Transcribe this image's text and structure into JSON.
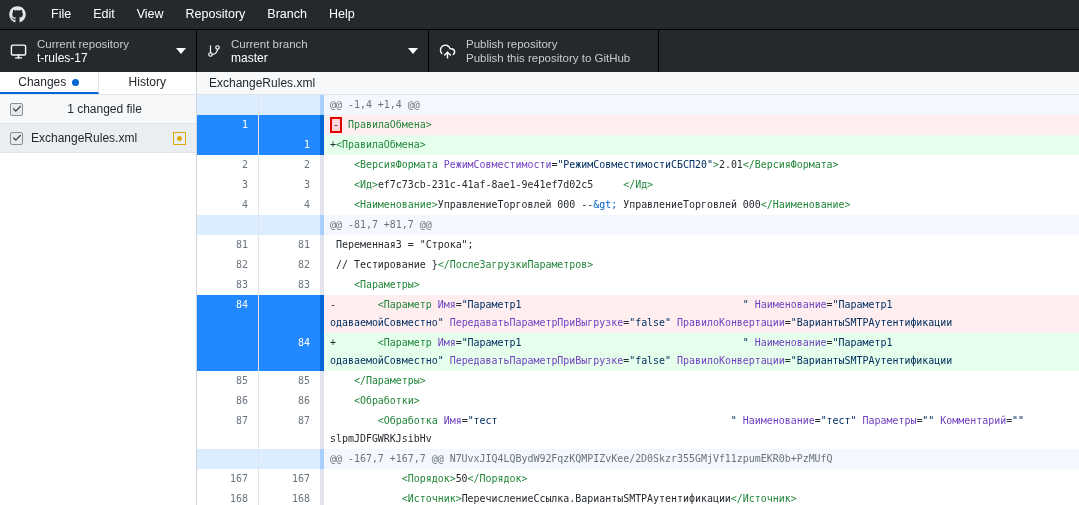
{
  "menu": [
    "File",
    "Edit",
    "View",
    "Repository",
    "Branch",
    "Help"
  ],
  "toolbar": {
    "repository": {
      "label": "Current repository",
      "value": "t-rules-17"
    },
    "branch": {
      "label": "Current branch",
      "value": "master"
    },
    "publish": {
      "label": "Publish repository",
      "value": "Publish this repository to GitHub"
    }
  },
  "tabs": [
    {
      "label": "Changes",
      "selected": true,
      "badge": true
    },
    {
      "label": "History",
      "selected": false,
      "badge": false
    }
  ],
  "changes": {
    "header": {
      "label": "1 changed file",
      "checked": true
    },
    "files": [
      {
        "name": "ExchangeRules.xml",
        "checked": true,
        "selected": true,
        "kind": "modified"
      }
    ]
  },
  "diff": {
    "file": "ExchangeRules.xml",
    "rows": [
      {
        "kind": "hunk",
        "lines": [
          [
            {
              "kind": "plain",
              "t": "@@ -1,4 +1,4 @@"
            }
          ]
        ]
      },
      {
        "kind": "del",
        "old": "1",
        "selected": true,
        "marker": true,
        "lines": [
          [
            {
              "kind": "text",
              "t": "-"
            },
            {
              "kind": "tag",
              "t": " ПравилаОбмена>"
            }
          ]
        ]
      },
      {
        "kind": "add",
        "new": "1",
        "selected": true,
        "lines": [
          [
            {
              "kind": "text",
              "t": "+"
            },
            {
              "kind": "tag",
              "t": "<ПравилаОбмена>"
            }
          ]
        ]
      },
      {
        "kind": "ctx",
        "old": "2",
        "new": "2",
        "selected": false,
        "lines": [
          [
            {
              "kind": "tag",
              "t": "    <ВерсияФормата"
            },
            {
              "kind": "attr",
              "t": " РежимСовместимости"
            },
            {
              "kind": "text",
              "t": "="
            },
            {
              "kind": "str",
              "t": "\"РежимСовместимостиСБСП20\""
            },
            {
              "kind": "tag",
              "t": ">"
            },
            {
              "kind": "text",
              "t": "2.01"
            },
            {
              "kind": "tag",
              "t": "</ВерсияФормата>"
            }
          ]
        ]
      },
      {
        "kind": "ctx",
        "old": "3",
        "new": "3",
        "selected": false,
        "lines": [
          [
            {
              "kind": "tag",
              "t": "    <Ид>"
            },
            {
              "kind": "text",
              "t": "ef7c73cb-231c-41af-8ae1-9e41ef7d02c5"
            },
            {
              "kind": "tag",
              "t": "     </Ид>"
            }
          ]
        ]
      },
      {
        "kind": "ctx",
        "old": "4",
        "new": "4",
        "selected": false,
        "lines": [
          [
            {
              "kind": "tag",
              "t": "    <Наименование>"
            },
            {
              "kind": "text",
              "t": "УправлениеТорговлей 000 --"
            },
            {
              "kind": "entity",
              "t": "&gt;"
            },
            {
              "kind": "text",
              "t": " УправлениеТорговлей 000"
            },
            {
              "kind": "tag",
              "t": "</Наименование>"
            }
          ]
        ]
      },
      {
        "kind": "hunk",
        "lines": [
          [
            {
              "kind": "plain",
              "t": "@@ -81,7 +81,7 @@"
            }
          ]
        ]
      },
      {
        "kind": "ctx",
        "old": "81",
        "new": "81",
        "selected": false,
        "lines": [
          [
            {
              "kind": "text",
              "t": " Переменная3 = \"Строка\";"
            }
          ]
        ]
      },
      {
        "kind": "ctx",
        "old": "82",
        "new": "82",
        "selected": false,
        "lines": [
          [
            {
              "kind": "text",
              "t": " // Тестирование }"
            },
            {
              "kind": "tag",
              "t": "</ПослеЗагрузкиПараметров>"
            }
          ]
        ]
      },
      {
        "kind": "ctx",
        "old": "83",
        "new": "83",
        "selected": false,
        "lines": [
          [
            {
              "kind": "tag",
              "t": "    <Параметры>"
            }
          ]
        ]
      },
      {
        "kind": "del",
        "old": "84",
        "selected": true,
        "lines": [
          [
            {
              "kind": "text",
              "t": "-"
            },
            {
              "kind": "tag",
              "t": "       <Параметр"
            },
            {
              "kind": "attr",
              "t": " Имя"
            },
            {
              "kind": "text",
              "t": "="
            },
            {
              "kind": "str",
              "t": "\"Параметр1                                     \""
            },
            {
              "kind": "attr",
              "t": " Наименование"
            },
            {
              "kind": "text",
              "t": "="
            },
            {
              "kind": "str",
              "t": "\"Параметр1"
            }
          ],
          [
            {
              "kind": "str",
              "t": "одаваемойСовместно\""
            },
            {
              "kind": "attr",
              "t": " ПередаватьПараметрПриВыгрузке"
            },
            {
              "kind": "text",
              "t": "="
            },
            {
              "kind": "str",
              "t": "\"false\""
            },
            {
              "kind": "attr",
              "t": " ПравилоКонвертации"
            },
            {
              "kind": "text",
              "t": "="
            },
            {
              "kind": "str",
              "t": "\"ВариантыSMTPАутентификации"
            }
          ]
        ]
      },
      {
        "kind": "add",
        "new": "84",
        "selected": true,
        "lines": [
          [
            {
              "kind": "text",
              "t": "+"
            },
            {
              "kind": "tag",
              "t": "       <Параметр"
            },
            {
              "kind": "attr",
              "t": " Имя"
            },
            {
              "kind": "text",
              "t": "="
            },
            {
              "kind": "str",
              "t": "\"Параметр1                                     \""
            },
            {
              "kind": "attr",
              "t": " Наименование"
            },
            {
              "kind": "text",
              "t": "="
            },
            {
              "kind": "str",
              "t": "\"Параметр1"
            }
          ],
          [
            {
              "kind": "str",
              "t": "одаваемойСовместно\""
            },
            {
              "kind": "attr",
              "t": " ПередаватьПараметрПриВыгрузке"
            },
            {
              "kind": "text",
              "t": "="
            },
            {
              "kind": "str",
              "t": "\"false\""
            },
            {
              "kind": "attr",
              "t": " ПравилоКонвертации"
            },
            {
              "kind": "text",
              "t": "="
            },
            {
              "kind": "str",
              "t": "\"ВариантыSMTPАутентификации"
            }
          ]
        ]
      },
      {
        "kind": "ctx",
        "old": "85",
        "new": "85",
        "selected": false,
        "lines": [
          [
            {
              "kind": "tag",
              "t": "    </Параметры>"
            }
          ]
        ]
      },
      {
        "kind": "ctx",
        "old": "86",
        "new": "86",
        "selected": false,
        "lines": [
          [
            {
              "kind": "tag",
              "t": "    <Обработки>"
            }
          ]
        ]
      },
      {
        "kind": "ctx",
        "old": "87",
        "new": "87",
        "selected": false,
        "lines": [
          [
            {
              "kind": "tag",
              "t": "        <Обработка"
            },
            {
              "kind": "attr",
              "t": " Имя"
            },
            {
              "kind": "text",
              "t": "="
            },
            {
              "kind": "str",
              "t": "\"тест                                       \""
            },
            {
              "kind": "attr",
              "t": " Наименование"
            },
            {
              "kind": "text",
              "t": "="
            },
            {
              "kind": "str",
              "t": "\"тест\""
            },
            {
              "kind": "attr",
              "t": " Параметры"
            },
            {
              "kind": "text",
              "t": "="
            },
            {
              "kind": "str",
              "t": "\"\""
            },
            {
              "kind": "attr",
              "t": " Комментарий"
            },
            {
              "kind": "text",
              "t": "="
            },
            {
              "kind": "str",
              "t": "\"\""
            }
          ],
          [
            {
              "kind": "text",
              "t": "slpmJDFGWRKJsibHv"
            }
          ]
        ]
      },
      {
        "kind": "hunk",
        "lines": [
          [
            {
              "kind": "plain",
              "t": "@@ -167,7 +167,7 @@ N7UvxJIQ4LQBydW92FqzKQMPIZvKee/2D0Skzr355GMjVf11zpumEKR0b+PzMUfQ"
            }
          ]
        ]
      },
      {
        "kind": "ctx",
        "old": "167",
        "new": "167",
        "selected": false,
        "lines": [
          [
            {
              "kind": "tag",
              "t": "            <Порядок>"
            },
            {
              "kind": "text",
              "t": "50"
            },
            {
              "kind": "tag",
              "t": "</Порядок>"
            }
          ]
        ]
      },
      {
        "kind": "ctx",
        "old": "168",
        "new": "168",
        "selected": false,
        "lines": [
          [
            {
              "kind": "tag",
              "t": "            <Источник>"
            },
            {
              "kind": "text",
              "t": "ПеречислениеСсылка.ВариантыSMTPАутентификации"
            },
            {
              "kind": "tag",
              "t": "</Источник>"
            }
          ]
        ]
      }
    ]
  }
}
